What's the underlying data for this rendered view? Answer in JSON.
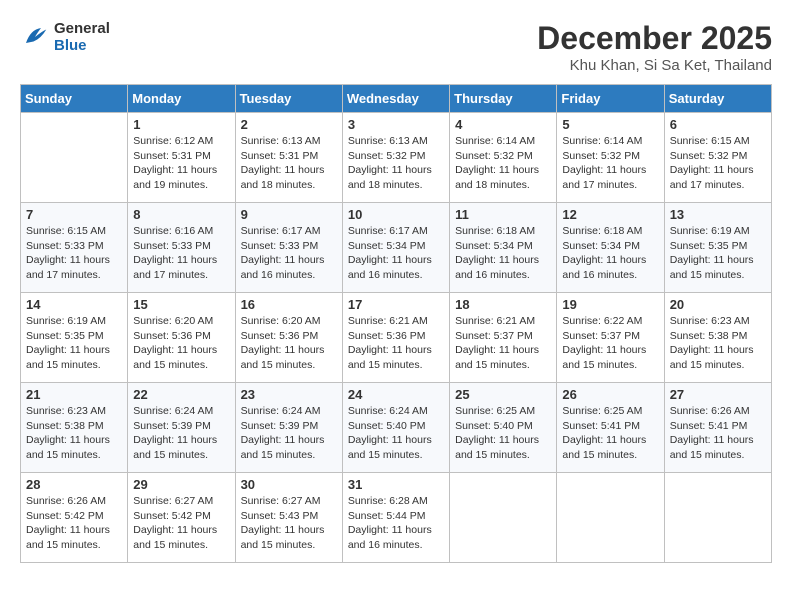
{
  "header": {
    "logo_line1": "General",
    "logo_line2": "Blue",
    "month_title": "December 2025",
    "location": "Khu Khan, Si Sa Ket, Thailand"
  },
  "weekdays": [
    "Sunday",
    "Monday",
    "Tuesday",
    "Wednesday",
    "Thursday",
    "Friday",
    "Saturday"
  ],
  "weeks": [
    [
      {
        "day": "",
        "info": ""
      },
      {
        "day": "1",
        "info": "Sunrise: 6:12 AM\nSunset: 5:31 PM\nDaylight: 11 hours\nand 19 minutes."
      },
      {
        "day": "2",
        "info": "Sunrise: 6:13 AM\nSunset: 5:31 PM\nDaylight: 11 hours\nand 18 minutes."
      },
      {
        "day": "3",
        "info": "Sunrise: 6:13 AM\nSunset: 5:32 PM\nDaylight: 11 hours\nand 18 minutes."
      },
      {
        "day": "4",
        "info": "Sunrise: 6:14 AM\nSunset: 5:32 PM\nDaylight: 11 hours\nand 18 minutes."
      },
      {
        "day": "5",
        "info": "Sunrise: 6:14 AM\nSunset: 5:32 PM\nDaylight: 11 hours\nand 17 minutes."
      },
      {
        "day": "6",
        "info": "Sunrise: 6:15 AM\nSunset: 5:32 PM\nDaylight: 11 hours\nand 17 minutes."
      }
    ],
    [
      {
        "day": "7",
        "info": "Sunrise: 6:15 AM\nSunset: 5:33 PM\nDaylight: 11 hours\nand 17 minutes."
      },
      {
        "day": "8",
        "info": "Sunrise: 6:16 AM\nSunset: 5:33 PM\nDaylight: 11 hours\nand 17 minutes."
      },
      {
        "day": "9",
        "info": "Sunrise: 6:17 AM\nSunset: 5:33 PM\nDaylight: 11 hours\nand 16 minutes."
      },
      {
        "day": "10",
        "info": "Sunrise: 6:17 AM\nSunset: 5:34 PM\nDaylight: 11 hours\nand 16 minutes."
      },
      {
        "day": "11",
        "info": "Sunrise: 6:18 AM\nSunset: 5:34 PM\nDaylight: 11 hours\nand 16 minutes."
      },
      {
        "day": "12",
        "info": "Sunrise: 6:18 AM\nSunset: 5:34 PM\nDaylight: 11 hours\nand 16 minutes."
      },
      {
        "day": "13",
        "info": "Sunrise: 6:19 AM\nSunset: 5:35 PM\nDaylight: 11 hours\nand 15 minutes."
      }
    ],
    [
      {
        "day": "14",
        "info": "Sunrise: 6:19 AM\nSunset: 5:35 PM\nDaylight: 11 hours\nand 15 minutes."
      },
      {
        "day": "15",
        "info": "Sunrise: 6:20 AM\nSunset: 5:36 PM\nDaylight: 11 hours\nand 15 minutes."
      },
      {
        "day": "16",
        "info": "Sunrise: 6:20 AM\nSunset: 5:36 PM\nDaylight: 11 hours\nand 15 minutes."
      },
      {
        "day": "17",
        "info": "Sunrise: 6:21 AM\nSunset: 5:36 PM\nDaylight: 11 hours\nand 15 minutes."
      },
      {
        "day": "18",
        "info": "Sunrise: 6:21 AM\nSunset: 5:37 PM\nDaylight: 11 hours\nand 15 minutes."
      },
      {
        "day": "19",
        "info": "Sunrise: 6:22 AM\nSunset: 5:37 PM\nDaylight: 11 hours\nand 15 minutes."
      },
      {
        "day": "20",
        "info": "Sunrise: 6:23 AM\nSunset: 5:38 PM\nDaylight: 11 hours\nand 15 minutes."
      }
    ],
    [
      {
        "day": "21",
        "info": "Sunrise: 6:23 AM\nSunset: 5:38 PM\nDaylight: 11 hours\nand 15 minutes."
      },
      {
        "day": "22",
        "info": "Sunrise: 6:24 AM\nSunset: 5:39 PM\nDaylight: 11 hours\nand 15 minutes."
      },
      {
        "day": "23",
        "info": "Sunrise: 6:24 AM\nSunset: 5:39 PM\nDaylight: 11 hours\nand 15 minutes."
      },
      {
        "day": "24",
        "info": "Sunrise: 6:24 AM\nSunset: 5:40 PM\nDaylight: 11 hours\nand 15 minutes."
      },
      {
        "day": "25",
        "info": "Sunrise: 6:25 AM\nSunset: 5:40 PM\nDaylight: 11 hours\nand 15 minutes."
      },
      {
        "day": "26",
        "info": "Sunrise: 6:25 AM\nSunset: 5:41 PM\nDaylight: 11 hours\nand 15 minutes."
      },
      {
        "day": "27",
        "info": "Sunrise: 6:26 AM\nSunset: 5:41 PM\nDaylight: 11 hours\nand 15 minutes."
      }
    ],
    [
      {
        "day": "28",
        "info": "Sunrise: 6:26 AM\nSunset: 5:42 PM\nDaylight: 11 hours\nand 15 minutes."
      },
      {
        "day": "29",
        "info": "Sunrise: 6:27 AM\nSunset: 5:42 PM\nDaylight: 11 hours\nand 15 minutes."
      },
      {
        "day": "30",
        "info": "Sunrise: 6:27 AM\nSunset: 5:43 PM\nDaylight: 11 hours\nand 15 minutes."
      },
      {
        "day": "31",
        "info": "Sunrise: 6:28 AM\nSunset: 5:44 PM\nDaylight: 11 hours\nand 16 minutes."
      },
      {
        "day": "",
        "info": ""
      },
      {
        "day": "",
        "info": ""
      },
      {
        "day": "",
        "info": ""
      }
    ]
  ]
}
